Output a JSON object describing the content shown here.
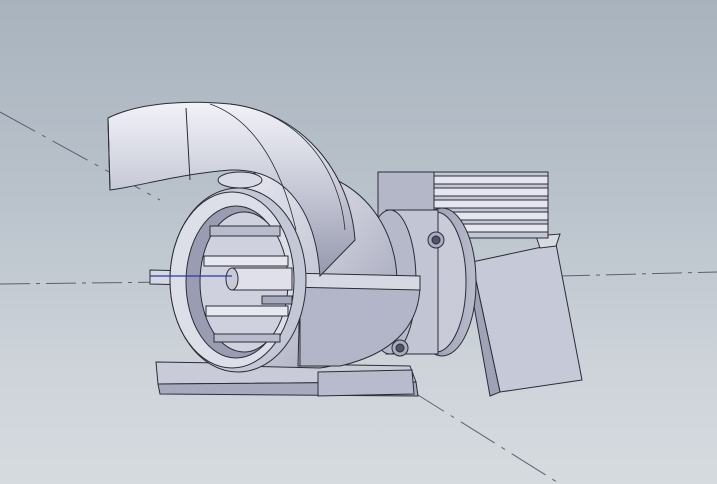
{
  "viewport": {
    "background_top": "#a9b3bd",
    "background_bottom": "#d6dbe0",
    "part_body_color": "#c9ccd9",
    "part_edge_color": "#2b2d36",
    "part_shade_color": "#8e92a8",
    "axis_line_color": "#5a6270"
  },
  "model": {
    "icon": "pump-3d-model",
    "components": [
      "volute-outlet",
      "inlet-ring",
      "shaft",
      "flange",
      "motor-fins",
      "support-bracket",
      "base-plate"
    ]
  }
}
